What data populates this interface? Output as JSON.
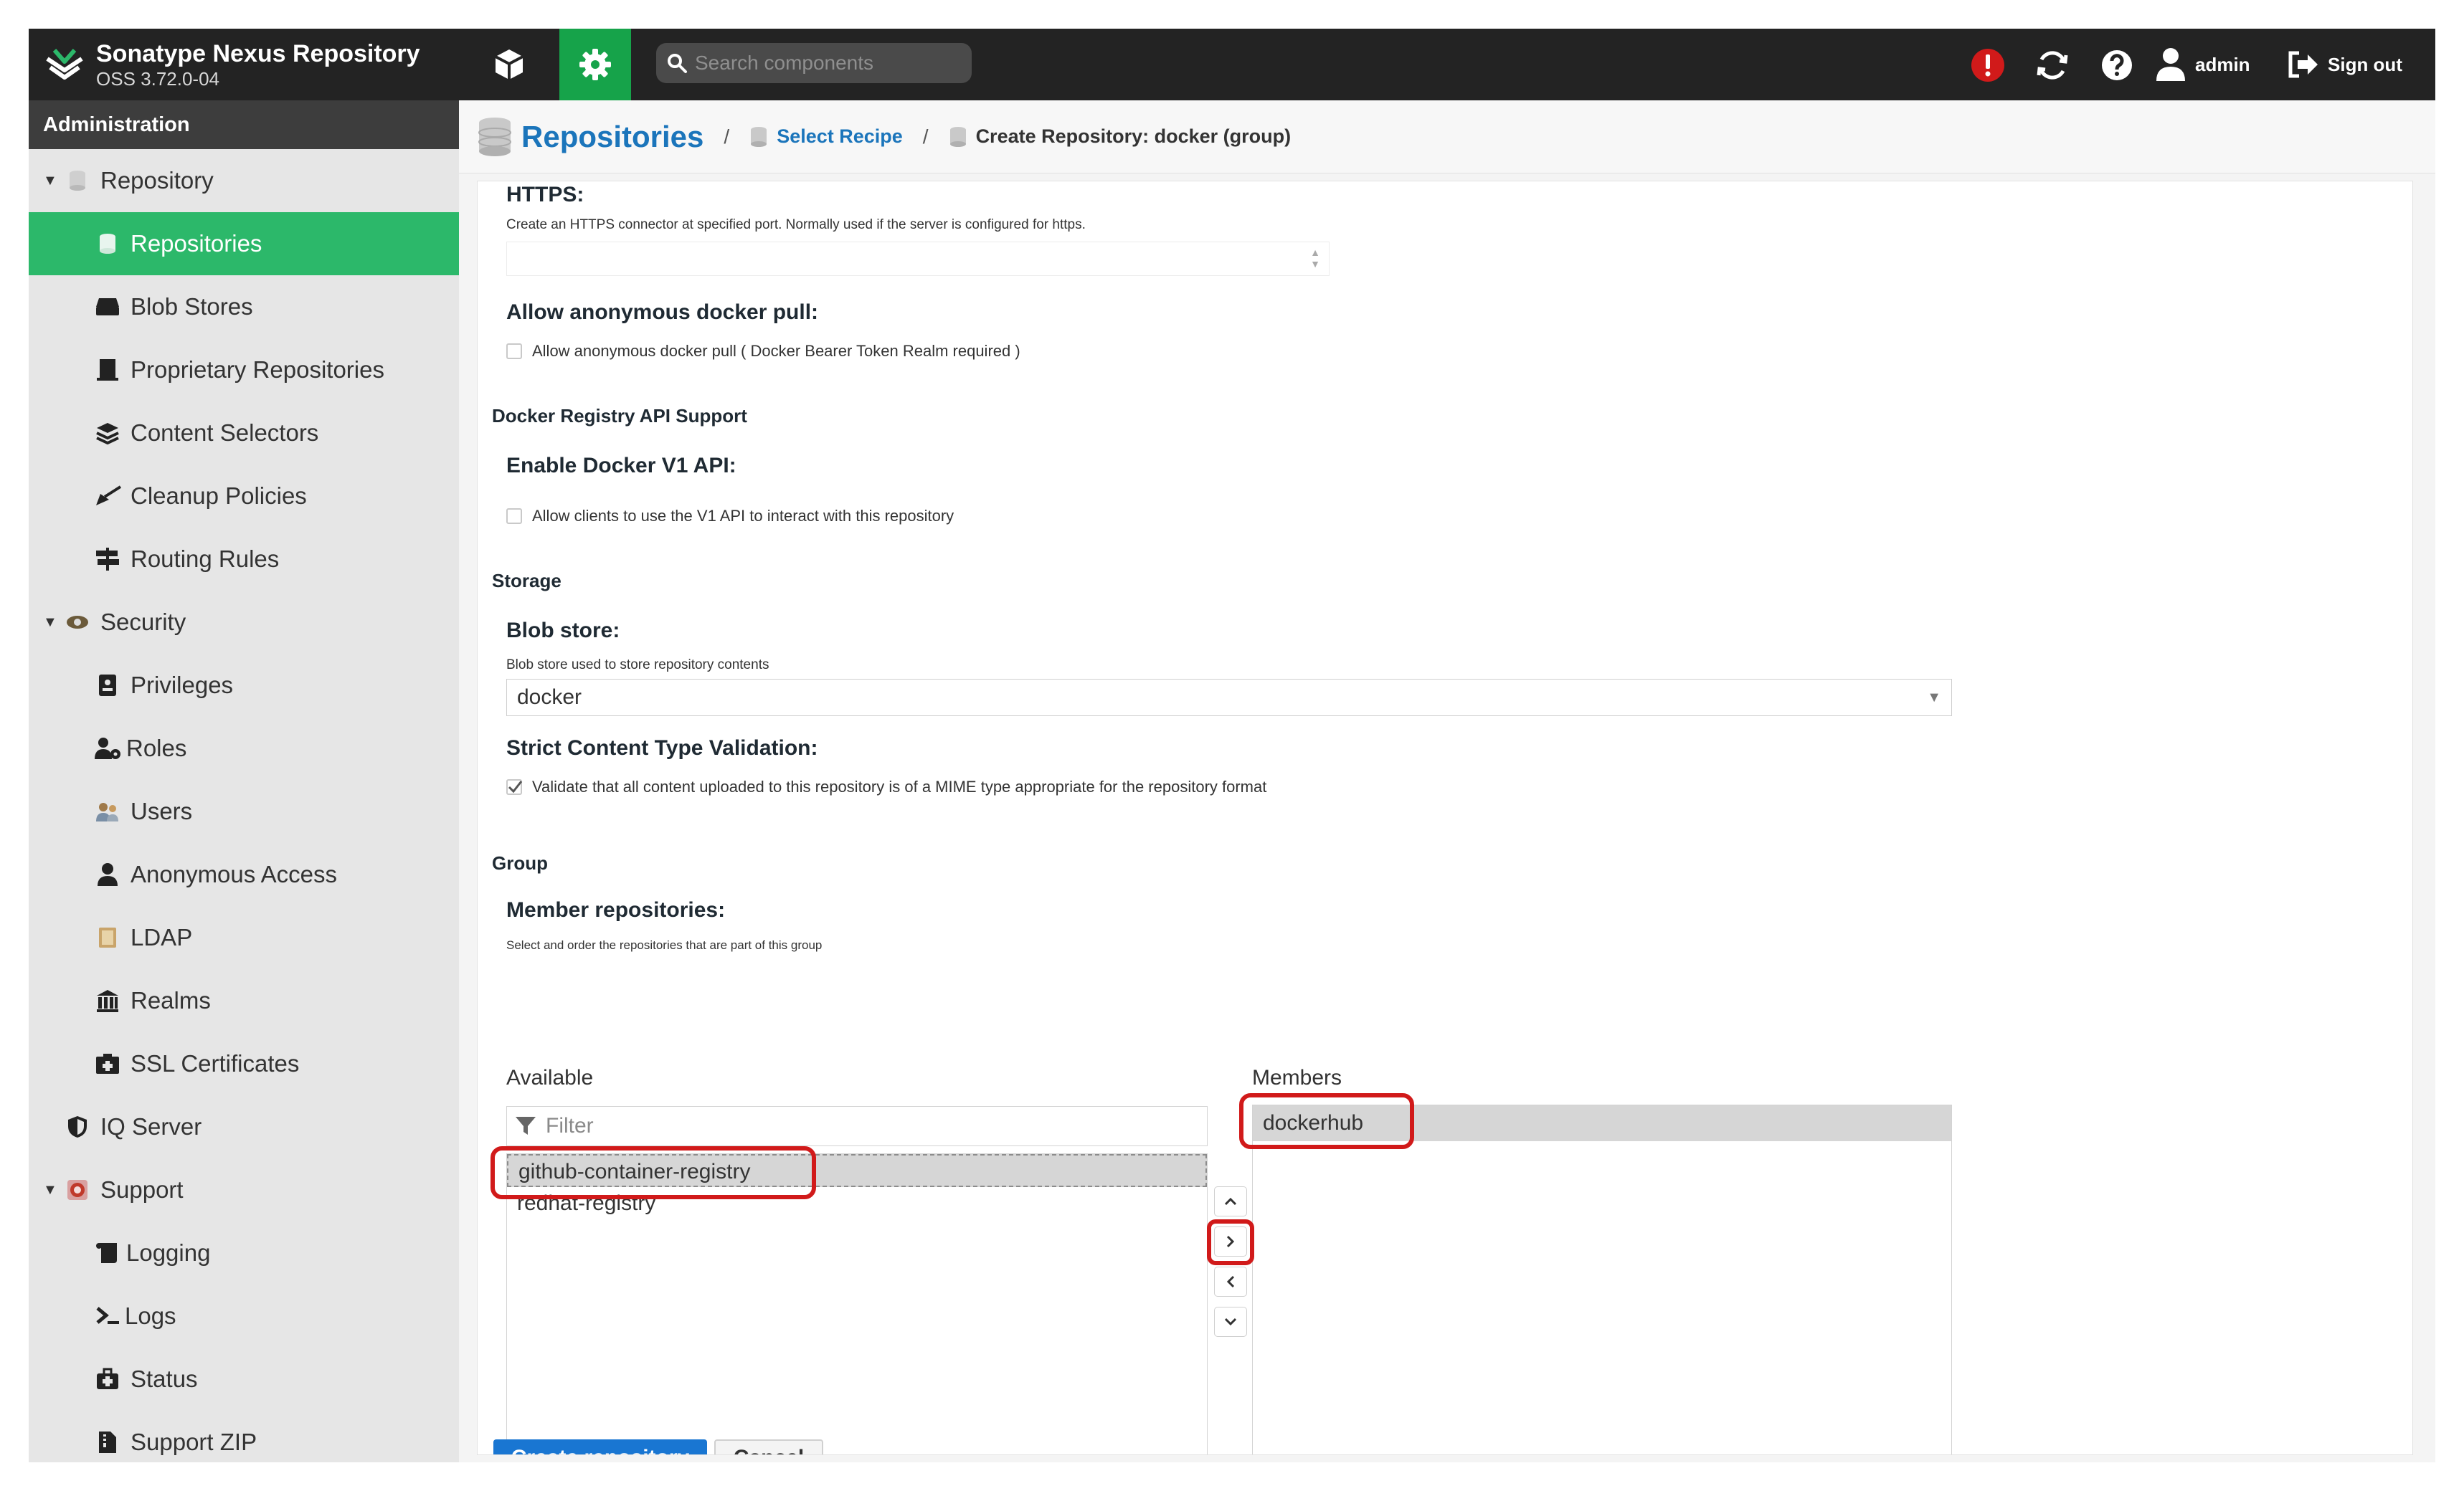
{
  "header": {
    "product_name": "Sonatype Nexus Repository",
    "version": "OSS 3.72.0-04",
    "search_placeholder": "Search components",
    "user_label": "admin",
    "signout_label": "Sign out",
    "accent_color": "#16a34a",
    "alert_color": "#d11a1a"
  },
  "sidebar": {
    "title": "Administration",
    "items": [
      {
        "label": "Repository",
        "icon": "database-icon",
        "group": true
      },
      {
        "label": "Repositories",
        "icon": "database-icon",
        "selected": true
      },
      {
        "label": "Blob Stores",
        "icon": "hard-drive-icon"
      },
      {
        "label": "Proprietary Repositories",
        "icon": "door-icon"
      },
      {
        "label": "Content Selectors",
        "icon": "layers-icon"
      },
      {
        "label": "Cleanup Policies",
        "icon": "broom-icon"
      },
      {
        "label": "Routing Rules",
        "icon": "signpost-icon"
      },
      {
        "label": "Security",
        "icon": "eye-icon",
        "group": true
      },
      {
        "label": "Privileges",
        "icon": "badge-icon"
      },
      {
        "label": "Roles",
        "icon": "users-cog-icon"
      },
      {
        "label": "Users",
        "icon": "users-icon"
      },
      {
        "label": "Anonymous Access",
        "icon": "user-icon"
      },
      {
        "label": "LDAP",
        "icon": "book-icon"
      },
      {
        "label": "Realms",
        "icon": "building-icon"
      },
      {
        "label": "SSL Certificates",
        "icon": "certificate-icon"
      },
      {
        "label": "IQ Server",
        "icon": "shield-icon"
      },
      {
        "label": "Support",
        "icon": "lifebuoy-icon",
        "group": true
      },
      {
        "label": "Logging",
        "icon": "scroll-icon"
      },
      {
        "label": "Logs",
        "icon": "terminal-icon"
      },
      {
        "label": "Status",
        "icon": "medkit-icon"
      },
      {
        "label": "Support ZIP",
        "icon": "file-zip-icon"
      }
    ]
  },
  "breadcrumb": {
    "root": "Repositories",
    "select_recipe": "Select Recipe",
    "current": "Create Repository: docker (group)",
    "separator": "/"
  },
  "form": {
    "https_label": "HTTPS:",
    "https_help": "Create an HTTPS connector at specified port. Normally used if the server is configured for https.",
    "anon_pull_label": "Allow anonymous docker pull:",
    "anon_pull_check": "Allow anonymous docker pull ( Docker Bearer Token Realm required )",
    "registry_api_section": "Docker Registry API Support",
    "v1_label": "Enable Docker V1 API:",
    "v1_check": "Allow clients to use the V1 API to interact with this repository",
    "storage_section": "Storage",
    "blob_label": "Blob store:",
    "blob_help": "Blob store used to store repository contents",
    "blob_value": "docker",
    "strict_label": "Strict Content Type Validation:",
    "strict_check": "Validate that all content uploaded to this repository is of a MIME type appropriate for the repository format",
    "group_section": "Group",
    "members_label": "Member repositories:",
    "members_help": "Select and order the repositories that are part of this group",
    "available_label": "Available",
    "members_col_label": "Members",
    "filter_placeholder": "Filter",
    "available": [
      "github-container-registry",
      "redhat-registry"
    ],
    "members": [
      "dockerhub"
    ],
    "create_label": "Create repository",
    "cancel_label": "Cancel"
  }
}
